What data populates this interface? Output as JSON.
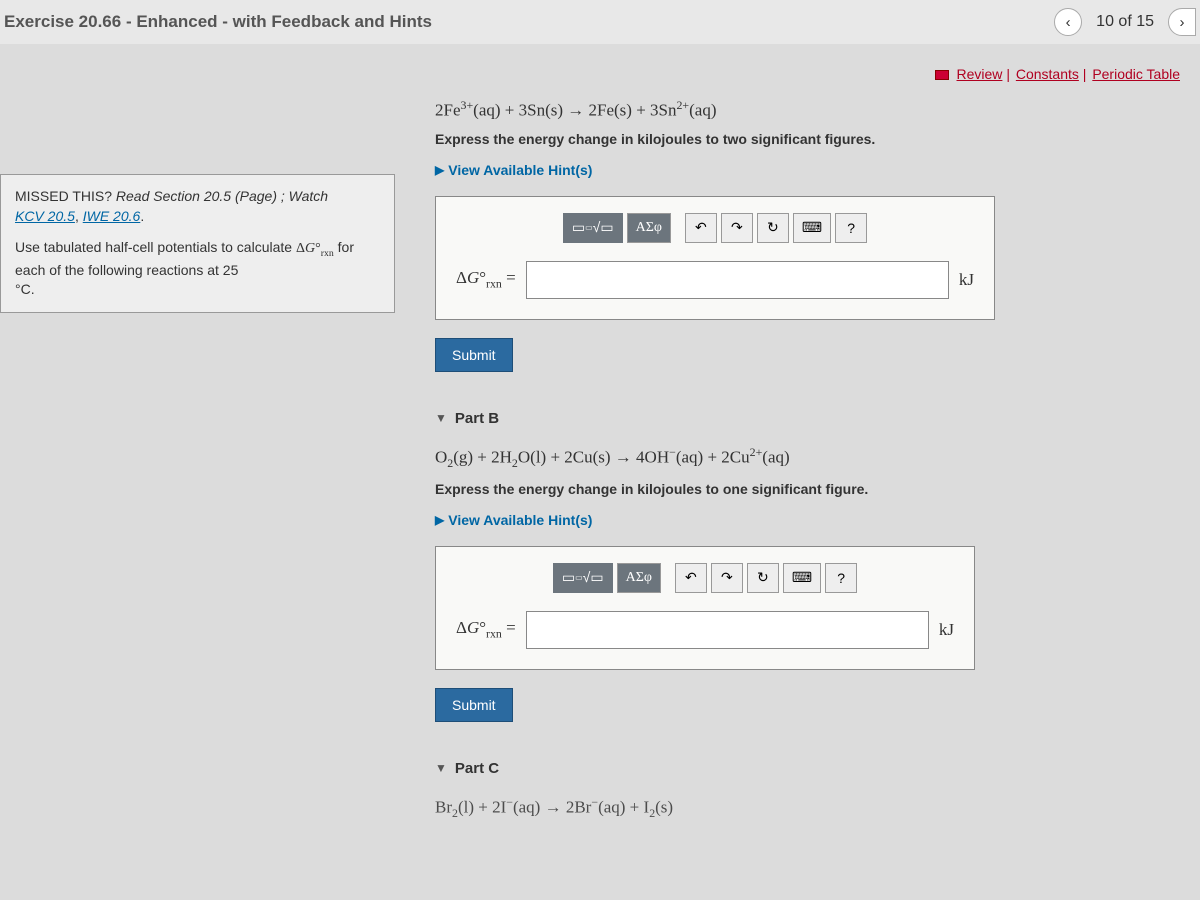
{
  "header": {
    "title": "Exercise 20.66 - Enhanced - with Feedback and Hints",
    "counter": "10 of 15"
  },
  "topLinks": {
    "review": "Review",
    "constants": "Constants",
    "periodic": "Periodic Table"
  },
  "leftPanel": {
    "missedLabel": "MISSED THIS?",
    "missedText": " Read Section 20.5 (Page) ; Watch ",
    "link1": "KCV 20.5",
    "link2": "IWE 20.6",
    "instruction1": "Use tabulated half-cell potentials to calculate ",
    "deltaG": "ΔG°",
    "rxn": "rxn",
    "instruction2": " for each of the following reactions at 25 ",
    "deg": "°C."
  },
  "partA": {
    "equation": "2Fe³⁺(aq) + 3Sn(s) → 2Fe(s) + 3Sn²⁺(aq)",
    "instruction": "Express the energy change in kilojoules to two significant figures.",
    "hints": "View Available Hint(s)",
    "label": "ΔG°",
    "labelSub": "rxn",
    "eq": " = ",
    "unit": "kJ",
    "symbols": "ΑΣφ",
    "submit": "Submit"
  },
  "partB": {
    "title": "Part B",
    "equation": "O₂(g) + 2H₂O(l) + 2Cu(s) → 4OH⁻(aq) + 2Cu²⁺(aq)",
    "instruction": "Express the energy change in kilojoules to one significant figure.",
    "hints": "View Available Hint(s)",
    "label": "ΔG°",
    "labelSub": "rxn",
    "eq": " = ",
    "unit": "kJ",
    "symbols": "ΑΣφ",
    "submit": "Submit"
  },
  "partC": {
    "title": "Part C",
    "equation": "Br₂(l) + 2I⁻(aq) → 2Br⁻(aq) + I₂(s)"
  },
  "tools": {
    "templates": "□",
    "sqrt": "√",
    "undo": "↶",
    "redo": "↷",
    "reset": "↻",
    "keyboard": "⌨",
    "help": "?"
  }
}
